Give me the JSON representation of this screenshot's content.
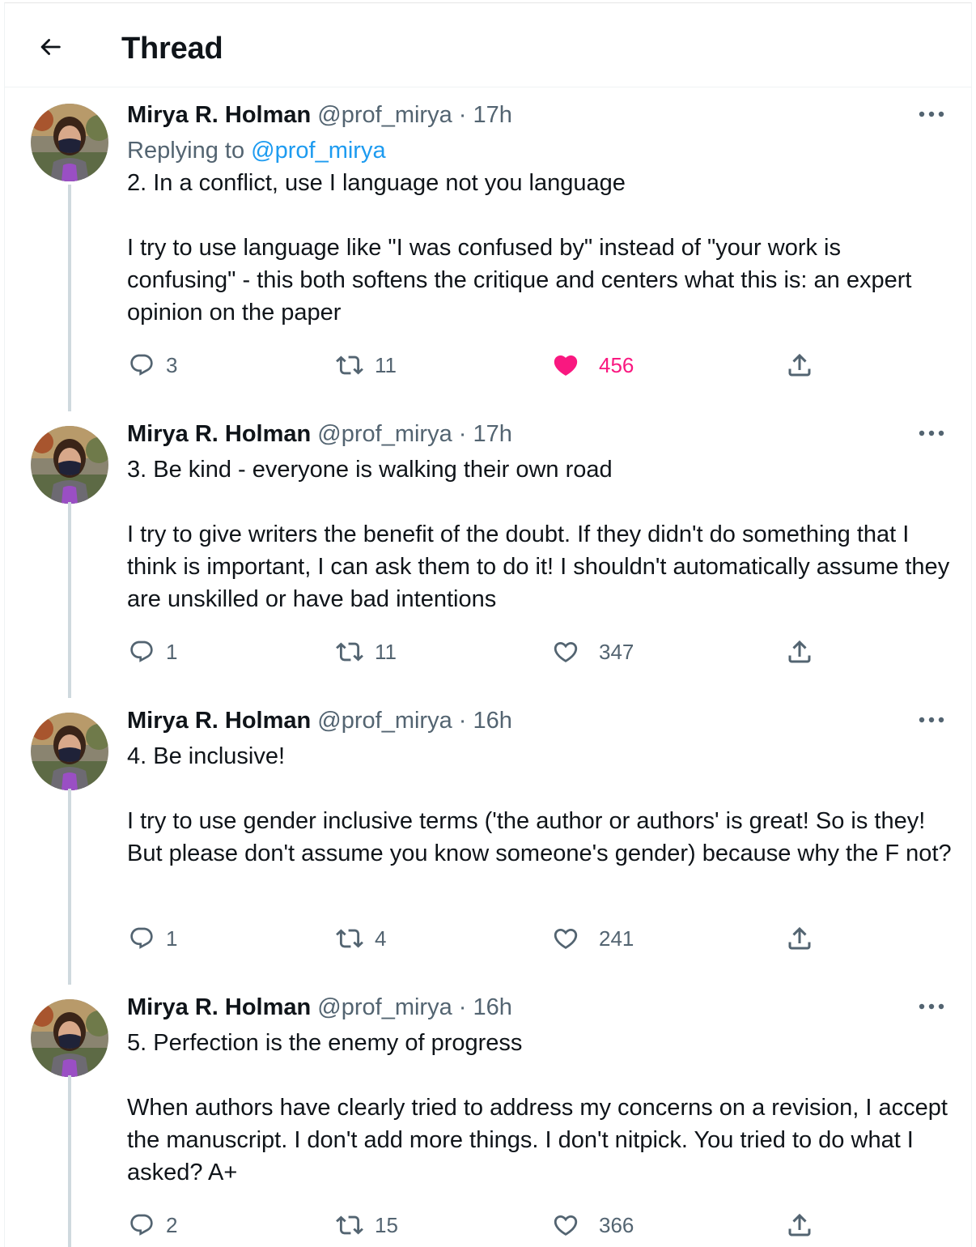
{
  "header": {
    "title": "Thread"
  },
  "colors": {
    "like_active": "#f91880",
    "link": "#1d9bf0",
    "secondary_text": "#536471",
    "thread_line": "#cfd9de"
  },
  "tweets": [
    {
      "name": "Mirya R. Holman",
      "handle": "@prof_mirya",
      "separator": "·",
      "time": "17h",
      "replying_prefix": "Replying to",
      "replying_handle": "@prof_mirya",
      "paragraphs": [
        "2. In a conflict, use I language not you language",
        "I try to use language like \"I was confused by\" instead of \"your work is confusing\" - this both softens the critique and centers what this is: an expert opinion on the paper"
      ],
      "replies": "3",
      "retweets": "11",
      "likes": "456",
      "liked": true
    },
    {
      "name": "Mirya R. Holman",
      "handle": "@prof_mirya",
      "separator": "·",
      "time": "17h",
      "paragraphs": [
        "3. Be kind - everyone is walking their own road",
        "I try to give writers the benefit of the doubt. If they didn't do something that I think is important, I can ask them to do it! I shouldn't automatically assume they are unskilled or have bad intentions"
      ],
      "replies": "1",
      "retweets": "11",
      "likes": "347",
      "liked": false
    },
    {
      "name": "Mirya R. Holman",
      "handle": "@prof_mirya",
      "separator": "·",
      "time": "16h",
      "paragraphs": [
        "4. Be inclusive!",
        "I try to use gender inclusive terms ('the author or authors' is great! So is they! But please don't assume you know someone's gender) because why the F not?"
      ],
      "replies": "1",
      "retweets": "4",
      "likes": "241",
      "liked": false
    },
    {
      "name": "Mirya R. Holman",
      "handle": "@prof_mirya",
      "separator": "·",
      "time": "16h",
      "paragraphs": [
        "5. Perfection is the enemy of progress",
        "When authors have clearly tried to address my concerns on a revision, I accept the manuscript. I don't add more things. I don't nitpick. You tried to do what I asked? A+"
      ],
      "replies": "2",
      "retweets": "15",
      "likes": "366",
      "liked": false
    }
  ]
}
